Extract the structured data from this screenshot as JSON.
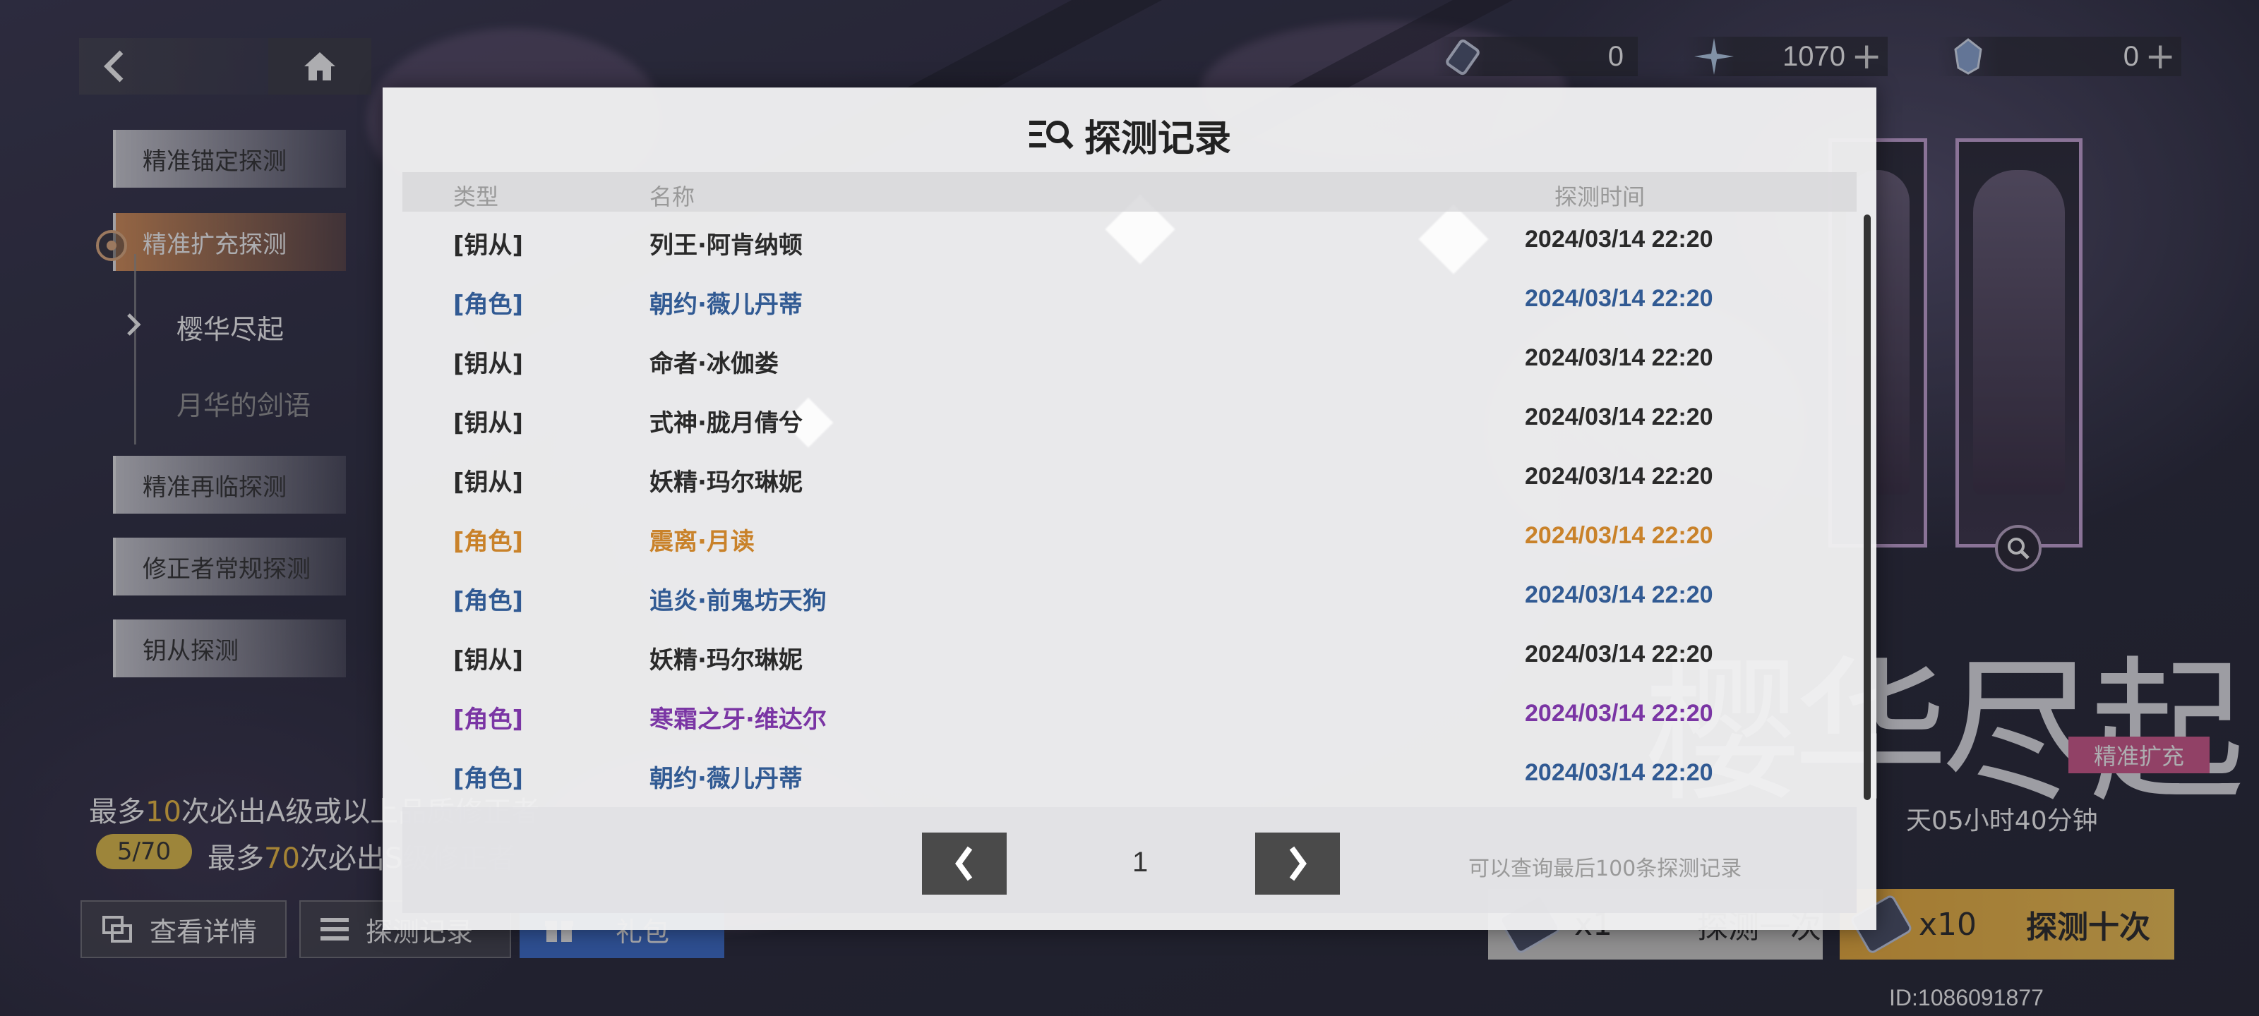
{
  "topbar": {
    "resources": [
      {
        "icon": "ticket-icon",
        "value": "0"
      },
      {
        "icon": "star-crystal-icon",
        "value": "1070",
        "plus": "+"
      },
      {
        "icon": "blue-crystal-icon",
        "value": "0",
        "plus": "+"
      }
    ]
  },
  "nav": {
    "items": [
      {
        "label": "精准锚定探测"
      },
      {
        "label": "精准扩充探测"
      },
      {
        "label": "精准再临探测"
      },
      {
        "label": "修正者常规探测"
      },
      {
        "label": "钥从探测"
      }
    ],
    "subitems": [
      {
        "label": "樱华尽起"
      },
      {
        "label": "月华的剑语"
      }
    ]
  },
  "pity": {
    "line1_prefix": "最多",
    "line1_num": "10",
    "line1_suffix": "次必出A级或以上品质修正者",
    "badge": "5/70",
    "line2_prefix": "最多",
    "line2_num": "70",
    "line2_suffix": "次必出S级修正者"
  },
  "bottom_buttons": {
    "details": "查看详情",
    "records": "探测记录",
    "gift": "礼包"
  },
  "banner": {
    "title": "樱华尽起",
    "tag": "精准扩充",
    "countdown": "天05小时40分钟",
    "pull_one_count": "x1",
    "pull_one_label": "探测一次",
    "pull_ten_count": "x10",
    "pull_ten_label": "探测十次",
    "user_id": "ID:1086091877"
  },
  "modal": {
    "title": "探测记录",
    "columns": {
      "type": "类型",
      "name": "名称",
      "time": "探测时间"
    },
    "rows": [
      {
        "type": "[钥从]",
        "name": "列王·阿肯纳顿",
        "time": "2024/03/14 22:20",
        "color": "#2a2a2a"
      },
      {
        "type": "[角色]",
        "name": "朝约·薇儿丹蒂",
        "time": "2024/03/14 22:20",
        "color": "#315a93"
      },
      {
        "type": "[钥从]",
        "name": "命者·冰伽娄",
        "time": "2024/03/14 22:20",
        "color": "#2a2a2a"
      },
      {
        "type": "[钥从]",
        "name": "式神·胧月倩兮",
        "time": "2024/03/14 22:20",
        "color": "#2a2a2a"
      },
      {
        "type": "[钥从]",
        "name": "妖精·玛尔琳妮",
        "time": "2024/03/14 22:20",
        "color": "#2a2a2a"
      },
      {
        "type": "[角色]",
        "name": "震离·月读",
        "time": "2024/03/14 22:20",
        "color": "#c9822a"
      },
      {
        "type": "[角色]",
        "name": "追炎·前鬼坊天狗",
        "time": "2024/03/14 22:20",
        "color": "#315a93"
      },
      {
        "type": "[钥从]",
        "name": "妖精·玛尔琳妮",
        "time": "2024/03/14 22:20",
        "color": "#2a2a2a"
      },
      {
        "type": "[角色]",
        "name": "寒霜之牙·维达尔",
        "time": "2024/03/14 22:20",
        "color": "#7a35a4"
      },
      {
        "type": "[角色]",
        "name": "朝约·薇儿丹蒂",
        "time": "2024/03/14 22:20",
        "color": "#315a93"
      }
    ],
    "pager": {
      "prev": "❮",
      "page": "1",
      "next": "❯",
      "note": "可以查询最后100条探测记录"
    }
  }
}
